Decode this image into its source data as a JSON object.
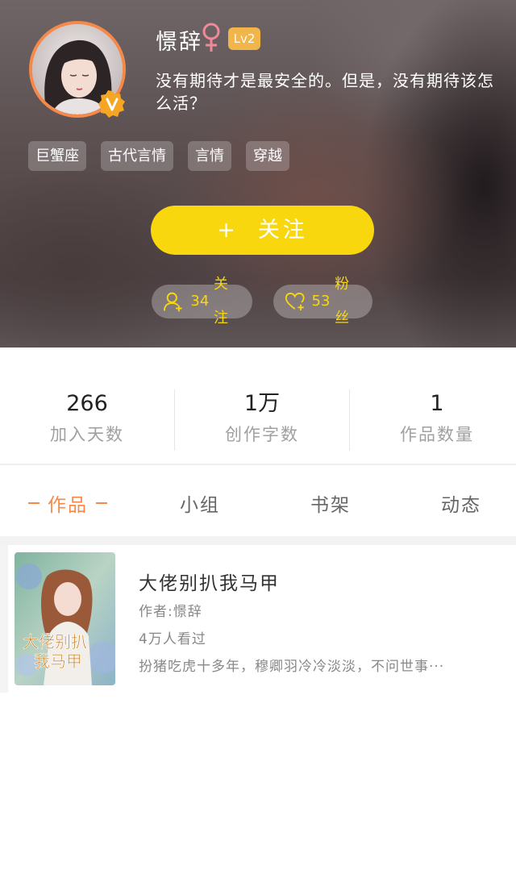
{
  "profile": {
    "nickname": "憬辞",
    "gender_icon": "female-icon",
    "level": "Lv2",
    "motto": "没有期待才是最安全的。但是，没有期待该怎么活？",
    "tags": [
      "巨蟹座",
      "古代言情",
      "言情",
      "穿越"
    ],
    "follow_button": {
      "plus": "+",
      "label": "关注"
    },
    "following": {
      "icon": "user-plus-icon",
      "count": "34",
      "label": "关注"
    },
    "fans": {
      "icon": "heart-plus-icon",
      "count": "53",
      "label": "粉丝"
    }
  },
  "stats": [
    {
      "value": "266",
      "label": "加入天数"
    },
    {
      "value": "1万",
      "label": "创作字数"
    },
    {
      "value": "1",
      "label": "作品数量"
    }
  ],
  "tabs": {
    "works": "作品",
    "groups": "小组",
    "bookshelf": "书架",
    "activity": "动态"
  },
  "works": [
    {
      "cover_text": "大佬别扒我马甲",
      "title": "大佬别扒我马甲",
      "author": "作者:憬辞",
      "views": "4万人看过",
      "description": "扮猪吃虎十多年，穆卿羽冷冷淡淡，不问世事···"
    }
  ],
  "colors": {
    "accent_orange": "#f5894a",
    "follow_yellow": "#f8d70f",
    "level_badge": "#f2b54a",
    "verified_badge": "#f5a623"
  }
}
